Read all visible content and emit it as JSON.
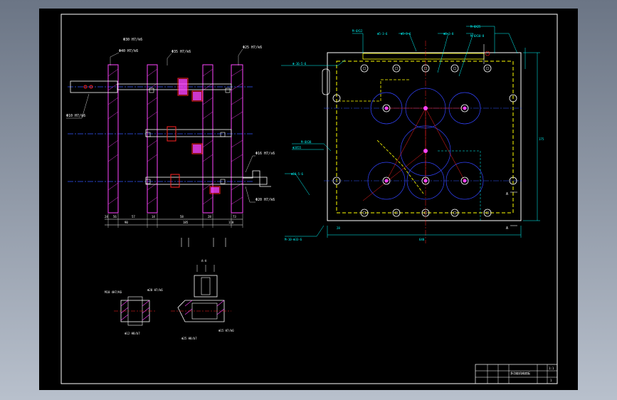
{
  "drawing": {
    "colors": {
      "background": "#000000",
      "frame": "#ffffff",
      "section_hatch": "#ff44ff",
      "centerline": "#3355ff",
      "gear_circles": "#3344ff",
      "dimension": "#00ffff",
      "hidden_line": "#ffff00",
      "red_lines": "#ff2222",
      "leader_text": "#00ffff"
    },
    "left_view": {
      "labels": {
        "top1": "Φ30 H7/k6",
        "top2": "Φ40 H7/k6",
        "fit1": "Φ35 H7/k6",
        "fit2": "Φ25 H7/k6",
        "left_fit": "Φ10 H7/k6",
        "right_fit1": "Φ16 H7/s6",
        "right_fit2": "Φ20 H7/k6"
      },
      "dims": [
        "24",
        "56",
        "57",
        "14",
        "58",
        "28",
        "73",
        "90",
        "185",
        "110"
      ]
    },
    "right_view": {
      "labels": {
        "top_left": "M-6X12",
        "top_a": "Φ5-3-6",
        "top_b": "Φ5-3-6",
        "top_c": "Φ6-3-8",
        "top_right1": "M-8X25",
        "top_right2": "M-6X10-8",
        "left_1": "Φ-16-5-6",
        "left_2": "M-8X38",
        "left_3": "Φ3X55",
        "left_4": "Φ16-5-6",
        "bottom_left": "M-10-Φ33-6",
        "dim_width": "640",
        "dim_height": "175",
        "dim_small": "28",
        "section_mark_top": "A",
        "section_mark_bottom": "A"
      }
    },
    "details": {
      "label_a": "M10 4H7/K6",
      "label_b": "Φ20 H7/k6",
      "label_c": "Φ12 H8/b7",
      "label_d": "Φ25 H8/b7",
      "label_e": "Φ15 H7/k6",
      "section_mark": "A-A"
    },
    "title_block": {
      "title": "多功能机械底板",
      "scale": "1:1",
      "sheet": "1"
    }
  }
}
